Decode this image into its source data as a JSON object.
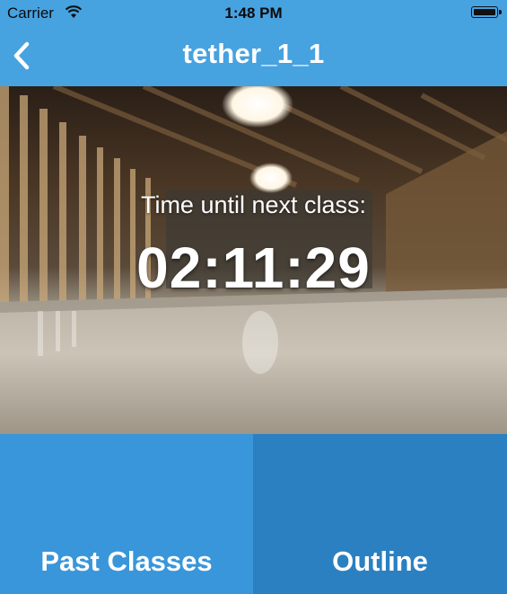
{
  "status_bar": {
    "carrier": "Carrier",
    "time": "1:48 PM",
    "wifi_icon": "wifi-icon",
    "battery_icon": "battery-icon"
  },
  "nav": {
    "title": "tether_1_1",
    "back_icon": "chevron-left-icon"
  },
  "countdown": {
    "label": "Time until next class:",
    "value": "02:11:29"
  },
  "actions": {
    "past_classes": "Past Classes",
    "outline": "Outline"
  },
  "colors": {
    "header": "#47a2e0",
    "tile_left": "#3996da",
    "tile_right": "#2b80c1",
    "text": "#ffffff"
  }
}
